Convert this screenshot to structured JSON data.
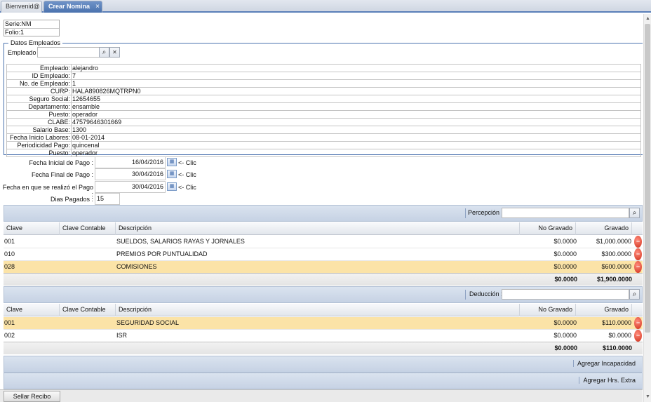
{
  "tabs": [
    {
      "label": "Bienvenid@",
      "active": false
    },
    {
      "label": "Crear Nomina",
      "active": true
    }
  ],
  "header": {
    "serie": {
      "label": "Serie:",
      "value": "NM"
    },
    "folio": {
      "label": "Folio:",
      "value": "1"
    }
  },
  "datos_empleados": {
    "legend": "Datos Empleados",
    "empleado_label": "Empleado :",
    "empleado_value": "",
    "fields": [
      {
        "label": "Empleado:",
        "value": "alejandro"
      },
      {
        "label": "ID Empleado:",
        "value": "7"
      },
      {
        "label": "No. de Empleado:",
        "value": "1"
      },
      {
        "label": "CURP:",
        "value": "HALA890826MQTRPN0"
      },
      {
        "label": "Seguro Social:",
        "value": "12654655"
      },
      {
        "label": "Departamento:",
        "value": "ensamble"
      },
      {
        "label": "Puesto:",
        "value": "operador"
      },
      {
        "label": "CLABE:",
        "value": "47579646301669"
      },
      {
        "label": "Salario Base:",
        "value": "1300"
      },
      {
        "label": "Fecha Inicio Labores:",
        "value": "08-01-2014"
      },
      {
        "label": "Periodicidad Pago:",
        "value": "quincenal"
      },
      {
        "label": "Puesto:",
        "value": "operador"
      }
    ]
  },
  "fechas": {
    "clic_text": "<- Clic",
    "inicial": {
      "label": "Fecha Inicial de Pago :",
      "value": "16/04/2016"
    },
    "final": {
      "label": "Fecha Final de Pago :",
      "value": "30/04/2016"
    },
    "realizo": {
      "label": "Fecha en que se realizó el Pago :",
      "value": "30/04/2016"
    },
    "dias": {
      "label": "Dias Pagados :",
      "value": "15"
    }
  },
  "columns": {
    "clave": "Clave",
    "clave_contable": "Clave Contable",
    "descripcion": "Descripción",
    "no_gravado": "No Gravado",
    "gravado": "Gravado"
  },
  "percepciones": {
    "search_label": "Percepción :",
    "search_value": "",
    "rows": [
      {
        "clave": "001",
        "clave_contable": "",
        "descripcion": "SUELDOS, SALARIOS RAYAS Y JORNALES",
        "no_gravado": "$0.0000",
        "gravado": "$1,000.0000"
      },
      {
        "clave": "010",
        "clave_contable": "",
        "descripcion": "PREMIOS POR PUNTUALIDAD",
        "no_gravado": "$0.0000",
        "gravado": "$300.0000"
      },
      {
        "clave": "028",
        "clave_contable": "",
        "descripcion": "COMISIONES",
        "no_gravado": "$0.0000",
        "gravado": "$600.0000"
      }
    ],
    "total_no_gravado": "$0.0000",
    "total_gravado": "$1,900.0000"
  },
  "deducciones": {
    "search_label": "Deducción :",
    "search_value": "",
    "rows": [
      {
        "clave": "001",
        "clave_contable": "",
        "descripcion": "SEGURIDAD SOCIAL",
        "no_gravado": "$0.0000",
        "gravado": "$110.0000"
      },
      {
        "clave": "002",
        "clave_contable": "",
        "descripcion": "ISR",
        "no_gravado": "$0.0000",
        "gravado": "$0.0000"
      }
    ],
    "total_no_gravado": "$0.0000",
    "total_gravado": "$110.0000"
  },
  "buttons": {
    "agregar_incapacidad": "Agregar Incapacidad",
    "agregar_hrs_extra": "Agregar Hrs. Extra",
    "sellar_recibo": "Sellar Recibo"
  },
  "icons": {
    "close": "×",
    "search": "⌕",
    "clear": "✕",
    "calendar": "▦",
    "delete": "−"
  },
  "colors": {
    "accent": "#4a72ae",
    "selected_row": "#fbe3a7",
    "delete_icon": "#d0321e"
  }
}
